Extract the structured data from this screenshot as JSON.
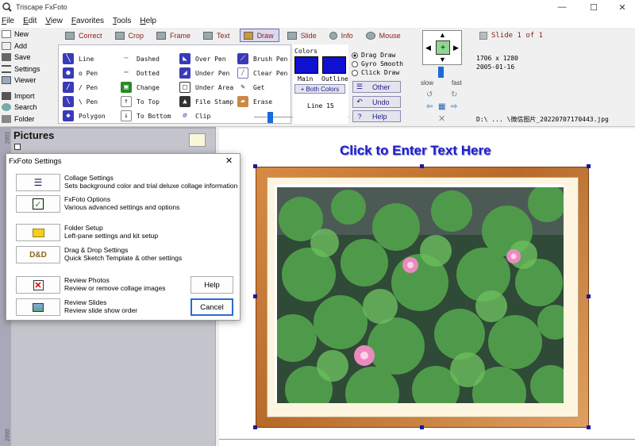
{
  "window": {
    "title": "Triscape FxFoto",
    "min": "—",
    "max": "☐",
    "close": "✕"
  },
  "menu": [
    "File",
    "Edit",
    "View",
    "Favorites",
    "Tools",
    "Help"
  ],
  "left_commands": [
    "New",
    "Add",
    "Save",
    "Settings",
    "Viewer",
    "Import",
    "Search",
    "Folder"
  ],
  "tabs": [
    "Correct",
    "Crop",
    "Frame",
    "Text",
    "Draw",
    "Slide",
    "Info",
    "Mouse"
  ],
  "draw": {
    "col1": [
      "Line",
      "o Pen",
      "/ Pen",
      "\\ Pen",
      "Polygon"
    ],
    "col2": [
      "Dashed",
      "Dotted",
      "Change",
      "To Top",
      "To Bottom"
    ],
    "col3": [
      "Over Pen",
      "Under Pen",
      "Under Area",
      "File Stamp",
      "Clip"
    ],
    "col4": [
      "Brush Pen",
      "Clear Pen",
      "Get",
      "Erase"
    ]
  },
  "colors": {
    "heading": "Colors",
    "main": "Main",
    "outline": "Outline",
    "both": "Both Colors",
    "line": "Line 15",
    "swatch": "#1010d0"
  },
  "draw_modes": [
    "Drag Draw",
    "Gyro Smooth",
    "Click Draw"
  ],
  "side_buttons": [
    "Other",
    "Undo",
    "Help"
  ],
  "speed": {
    "slow": "slow",
    "fast": "fast"
  },
  "info": {
    "slide": "Slide 1 of 1",
    "dimensions": "1706 x 1280",
    "date": "2005-01-16",
    "path": "D:\\ ... \\微信图片_20220707170443.jpg"
  },
  "pictures_heading": "Pictures",
  "canvas_title": "Click to Enter Text Here",
  "dialog": {
    "title": "FxFoto Settings",
    "items": [
      {
        "title": "Collage Settings",
        "desc": "Sets background color and trial deluxe collage information"
      },
      {
        "title": "FxFoto Options",
        "desc": "Various advanced settings and options"
      },
      {
        "title": "Folder Setup",
        "desc": "Left-pane settings and kit setup"
      },
      {
        "title": "Drag & Drop Settings",
        "desc": "Quick Sketch Template & other settings"
      },
      {
        "title": "Review Photos",
        "desc": "Review or remove collage images"
      },
      {
        "title": "Review Slides",
        "desc": "Review slide show order"
      }
    ],
    "dd_icon": "D&D",
    "help": "Help",
    "cancel": "Cancel"
  },
  "ruler_labels": [
    "2001",
    "2000"
  ]
}
